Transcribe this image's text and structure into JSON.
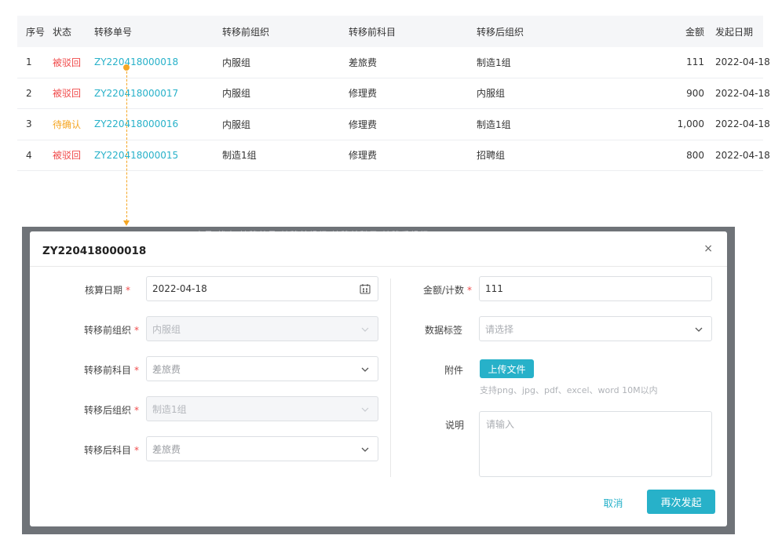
{
  "table": {
    "headers": {
      "idx": "序号",
      "status": "状态",
      "no": "转移单号",
      "before": "转移前组织",
      "subject": "转移前科目",
      "after": "转移后组织",
      "amount": "金额",
      "date": "发起日期"
    },
    "rows": [
      {
        "idx": "1",
        "status": "被驳回",
        "status_color": "#f04b4b",
        "no": "ZY220418000018",
        "before": "内服组",
        "subject": "差旅费",
        "after": "制造1组",
        "amount": "111",
        "date": "2022-04-18"
      },
      {
        "idx": "2",
        "status": "被驳回",
        "status_color": "#f04b4b",
        "no": "ZY220418000017",
        "before": "内服组",
        "subject": "修理费",
        "after": "内服组",
        "amount": "900",
        "date": "2022-04-18"
      },
      {
        "idx": "3",
        "status": "待确认",
        "status_color": "#f5a623",
        "no": "ZY220418000016",
        "before": "内服组",
        "subject": "修理费",
        "after": "制造1组",
        "amount": "1,000",
        "date": "2022-04-18"
      },
      {
        "idx": "4",
        "status": "被驳回",
        "status_color": "#f04b4b",
        "no": "ZY220418000015",
        "before": "制造1组",
        "subject": "修理费",
        "after": "招聘组",
        "amount": "800",
        "date": "2022-04-18"
      }
    ]
  },
  "colors": {
    "accent": "#27b1c9",
    "rejected": "#f04b4b",
    "pending": "#f5a623",
    "connector": "#f5a623"
  },
  "backdrop": {
    "ghost_headers": "序号  状态    转移单号                              转移前组织                              转移前科目                              转移后组织"
  },
  "modal": {
    "title": "ZY220418000018",
    "close": "×",
    "required_mark": "*",
    "fields": {
      "accounting_date": {
        "label": "核算日期",
        "value": "2022-04-18",
        "icon": "calendar-icon"
      },
      "org_before": {
        "label": "转移前组织",
        "value": "内服组",
        "disabled": true
      },
      "subject_before": {
        "label": "转移前科目",
        "value": "差旅费"
      },
      "org_after": {
        "label": "转移后组织",
        "value": "制造1组",
        "disabled": true
      },
      "subject_after": {
        "label": "转移后科目",
        "value": "差旅费"
      },
      "amount": {
        "label": "金额/计数",
        "value": "111"
      },
      "data_tag": {
        "label": "数据标签",
        "placeholder": "请选择"
      },
      "attachment": {
        "label": "附件",
        "button": "上传文件",
        "hint": "支持png、jpg、pdf、excel、word 10M以内"
      },
      "description": {
        "label": "说明",
        "placeholder": "请输入"
      }
    },
    "buttons": {
      "cancel": "取消",
      "resubmit": "再次发起"
    }
  }
}
